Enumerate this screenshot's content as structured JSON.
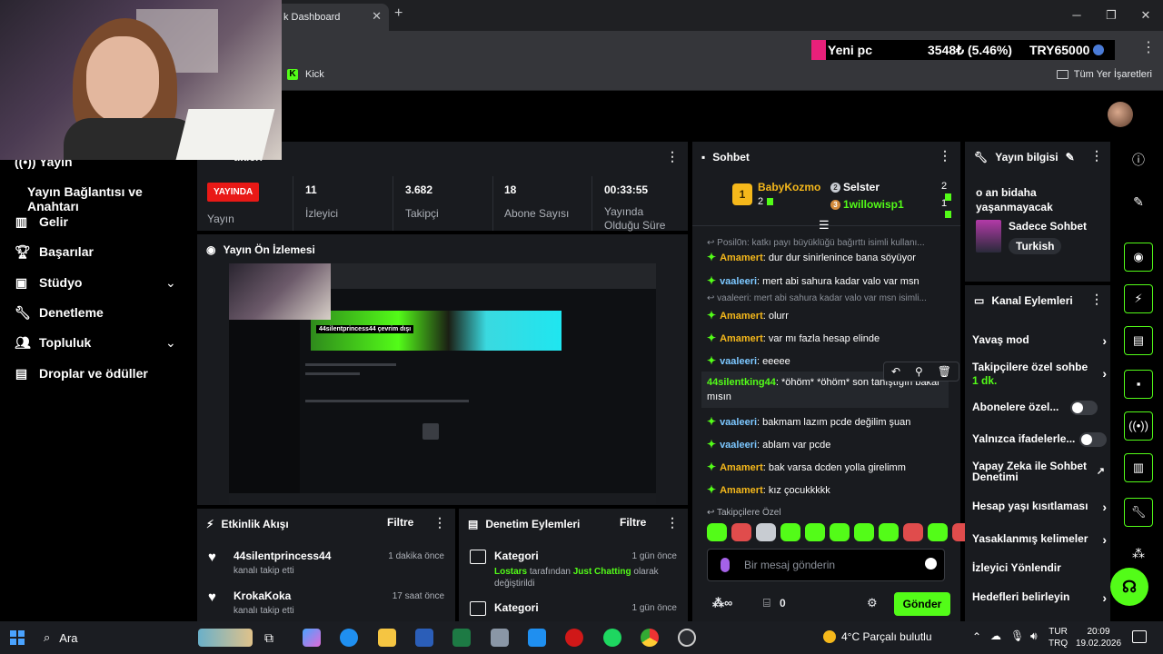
{
  "browser": {
    "tab_title": "k Dashboard",
    "bookmarks": {
      "kick": "Kick",
      "all": "Tüm Yer İşaretleri"
    }
  },
  "ticker": {
    "item1": "Yeni pc",
    "item2": "3548₺ (5.46%)",
    "item3": "TRY65000"
  },
  "sidebar": {
    "items": [
      {
        "label": "Yayın",
        "icon": "broadcast-icon"
      },
      {
        "label": "Yayın Bağlantısı ve Anahtarı"
      },
      {
        "label": "Gelir",
        "icon": "bar-chart-icon"
      },
      {
        "label": "Başarılar",
        "icon": "trophy-icon"
      },
      {
        "label": "Stüdyo",
        "icon": "studio-icon"
      },
      {
        "label": "Denetleme",
        "icon": "wrench-icon"
      },
      {
        "label": "Topluluk",
        "icon": "people-icon"
      },
      {
        "label": "Droplar ve ödüller",
        "icon": "gift-icon"
      }
    ]
  },
  "stats": {
    "title_partial": "tikleri",
    "live": "YAYINDA",
    "live_label": "Yayın",
    "viewers": {
      "value": "11",
      "label": "İzleyici"
    },
    "followers": {
      "value": "3.682",
      "label": "Takipçi"
    },
    "subs": {
      "value": "18",
      "label": "Abone Sayısı"
    },
    "uptime": {
      "value": "00:33:55",
      "label": "Yayında Olduğu Süre"
    }
  },
  "preview": {
    "title": "Yayın Ön İzlemesi",
    "banner": "44silentprincess44 çevrim dışı"
  },
  "activity": {
    "title": "Etkinlik Akışı",
    "filter": "Filtre",
    "items": [
      {
        "name": "44silentprincess44",
        "sub": "kanalı takip etti",
        "time": "1 dakika önce"
      },
      {
        "name": "KrokaKoka",
        "sub": "kanalı takip etti",
        "time": "17 saat önce"
      }
    ]
  },
  "audit": {
    "title": "Denetim Eylemleri",
    "filter": "Filtre",
    "items": [
      {
        "name": "Kategori",
        "time": "1 gün önce",
        "actor": "Lostars",
        "mid": " tarafından ",
        "target": "Just Chatting",
        "end": " olarak değiştirildi"
      },
      {
        "name": "Kategori",
        "time": "1 gün önce"
      }
    ]
  },
  "chat": {
    "title": "Sohbet",
    "leaderboard": {
      "first": {
        "name": "BabyKozmo",
        "value": "2",
        "rank": "1"
      },
      "second": {
        "name": "Selster",
        "value": "2"
      },
      "third": {
        "name": "1willowisp1",
        "value": "1"
      }
    },
    "messages": [
      {
        "type": "reply",
        "text": "Posil0n: katkı payı büyüklüğü bağırttı isimli kullanı..."
      },
      {
        "type": "msg",
        "user": "Amamert",
        "color": "#f5b81b",
        "text": "dur dur sinirlenince bana söyüyor"
      },
      {
        "type": "msg",
        "user": "vaaleeri",
        "color": "#7cc7ff",
        "text": "mert abi sahura kadar valo var msn"
      },
      {
        "type": "reply",
        "text": "vaaleeri: mert abi sahura kadar valo var msn isimli..."
      },
      {
        "type": "msg",
        "user": "Amamert",
        "color": "#f5b81b",
        "text": "olurr"
      },
      {
        "type": "msg",
        "user": "Amamert",
        "color": "#f5b81b",
        "text": "var mı fazla hesap elinde"
      },
      {
        "type": "msg",
        "user": "vaaleeri",
        "color": "#7cc7ff",
        "text": "eeeee"
      },
      {
        "type": "hover",
        "user": "44silentking44",
        "color": "#53fc18",
        "text": "*öhöm* *öhöm* son tanıştığın bakar mısın"
      },
      {
        "type": "msg",
        "user": "vaaleeri",
        "color": "#7cc7ff",
        "text": "bakmam lazım pcde değilim şuan"
      },
      {
        "type": "msg",
        "user": "vaaleeri",
        "color": "#7cc7ff",
        "text": "ablam var pcde"
      },
      {
        "type": "msg",
        "user": "Amamert",
        "color": "#f5b81b",
        "text": "bak varsa dcden yolla girelimm"
      },
      {
        "type": "msg",
        "user": "Amamert",
        "color": "#f5b81b",
        "text": "kız çocukkkkk"
      }
    ],
    "emote_label": "Takipçilere Özel",
    "placeholder": "Bir mesaj gönderin",
    "points": "0",
    "send": "Gönder"
  },
  "stream_info": {
    "title": "Yayın bilgisi",
    "stream_title": "o an bidaha yaşanmayacak",
    "category": "Sadece Sohbet",
    "tag": "Turkish"
  },
  "channel_actions": {
    "title": "Kanal Eylemleri",
    "items": [
      {
        "label": "Yavaş mod",
        "control": "arrow"
      },
      {
        "label": "Takipçilere özel sohbe",
        "sub": "1 dk.",
        "control": "arrow"
      },
      {
        "label": "Abonelere özel...",
        "control": "toggle"
      },
      {
        "label": "Yalnızca ifadelerle...",
        "control": "toggle"
      },
      {
        "label": "Yapay Zeka ile Sohbet Denetimi",
        "control": "external"
      },
      {
        "label": "Hesap yaşı kısıtlaması",
        "control": "arrow"
      },
      {
        "label": "Yasaklanmış kelimeler",
        "control": "arrow"
      },
      {
        "label": "İzleyici Yönlendir",
        "control": "none"
      },
      {
        "label": "Hedefleri belirleyin",
        "control": "arrow"
      }
    ]
  },
  "taskbar": {
    "search": "Ara",
    "weather": "4°C  Parçalı bulutlu",
    "lang1": "TUR",
    "lang2": "TRQ",
    "time": "20:09",
    "date": "19.02.2026"
  },
  "colors": {
    "accent": "#53fc18",
    "live": "#e91916",
    "gold": "#f5b81b"
  }
}
